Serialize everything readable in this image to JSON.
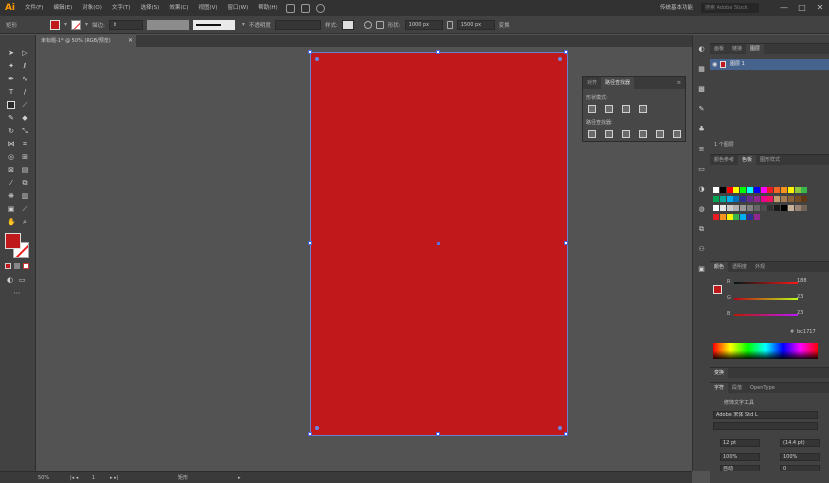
{
  "app": {
    "logo": "Ai"
  },
  "menu": [
    "文件(F)",
    "编辑(E)",
    "对象(O)",
    "文字(T)",
    "选择(S)",
    "效果(C)",
    "视图(V)",
    "窗口(W)",
    "帮助(H)"
  ],
  "topbar": {
    "layout_mode": "传统基本功能",
    "search_placeholder": "搜索 Adobe Stock",
    "minimize": "—",
    "maximize": "□",
    "close": "✕"
  },
  "control": {
    "selection_label": "矩形",
    "stroke_label": "描边:",
    "stroke_style": "基本",
    "opacity_label": "不透明度",
    "style_label": "样式:",
    "shape_label": "形状:",
    "width": "1000 px",
    "height": "1500 px",
    "transform_label": "变换"
  },
  "document": {
    "tab_label": "未标题-1* @ 50% (RGB/预览)",
    "close": "✕"
  },
  "colors": {
    "fill": "#c1181c",
    "artboard": "#c1181c",
    "selection": "#5a70dc",
    "ui_bg": "#535353"
  },
  "pathfinder": {
    "tabs": [
      "对齐",
      "路径查找器"
    ],
    "shape_modes_label": "形状模式:",
    "pathfinders_label": "路径查找器:"
  },
  "layers": {
    "tabs": [
      "画板",
      "链接",
      "图层"
    ],
    "layer_name": "图层 1",
    "count": "1 个图层"
  },
  "swatches": {
    "tabs": [
      "颜色参考",
      "色板",
      "图形样式"
    ]
  },
  "color": {
    "tabs": [
      "颜色",
      "透明度",
      "外观"
    ],
    "channels": [
      {
        "label": "R",
        "value": "188"
      },
      {
        "label": "G",
        "value": "23"
      },
      {
        "label": "B",
        "value": "23"
      }
    ],
    "hex_label": "#",
    "hex": "bc1717"
  },
  "transform": {
    "tab": "变换"
  },
  "character": {
    "tabs": [
      "字符",
      "段落",
      "OpenType"
    ],
    "touch_type": "修饰文字工具",
    "font_family": "Adobe 宋体 Std L",
    "font_size": "12 pt",
    "leading": "(14.4 pt)",
    "h_scale": "100%",
    "v_scale": "100%",
    "kerning": "自动",
    "tracking": "0"
  },
  "status": {
    "zoom": "50%",
    "artboard_nav": "1",
    "tool_name": "矩形"
  }
}
